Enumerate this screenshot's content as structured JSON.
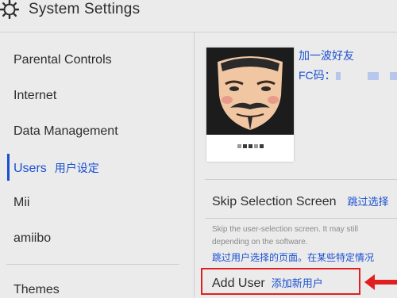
{
  "header": {
    "title": "System Settings",
    "icon": "gear-icon"
  },
  "sidebar": {
    "items": [
      {
        "label": "Parental Controls"
      },
      {
        "label": "Internet"
      },
      {
        "label": "Data Management"
      },
      {
        "label": "Users",
        "annotation": "用户设定",
        "active": true
      },
      {
        "label": "Mii"
      },
      {
        "label": "amiibo"
      },
      {
        "label": "Themes"
      }
    ]
  },
  "profile": {
    "friend_line1": "加一波好友",
    "friend_line2_prefix": "FC码："
  },
  "skip_selection": {
    "label": "Skip Selection Screen",
    "annotation": "跳过选择",
    "description_line1": "Skip the user-selection screen. It may still",
    "description_line2": "depending on the software.",
    "description_cn": "跳过用户选择的页面。在某些特定情况"
  },
  "add_user": {
    "label": "Add User",
    "annotation": "添加新用户"
  },
  "colors": {
    "accent": "#1a4fd1",
    "highlight": "#e02020",
    "background": "#ebebeb"
  }
}
